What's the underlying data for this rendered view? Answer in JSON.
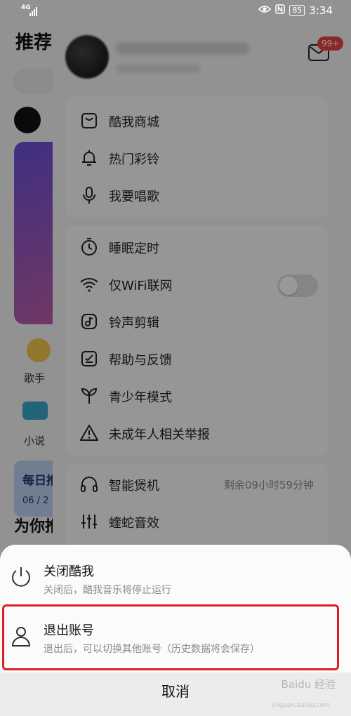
{
  "status_bar": {
    "network": "4G",
    "time": "3:34",
    "battery": "85",
    "icons": [
      "eye-icon",
      "nfc-icon",
      "signal-icon"
    ]
  },
  "background": {
    "title_partial": "推荐",
    "singer_label": "歌手",
    "novel_label": "小说",
    "daily_title": "每日推",
    "daily_date": "06 / 2",
    "section_title": "为你推"
  },
  "drawer": {
    "mail_badge": "99+",
    "group1": [
      {
        "icon": "shop-bag-icon",
        "label": "酷我商城"
      },
      {
        "icon": "bell-icon",
        "label": "热门彩铃"
      },
      {
        "icon": "microphone-icon",
        "label": "我要唱歌"
      }
    ],
    "group2": [
      {
        "icon": "timer-icon",
        "label": "睡眠定时"
      },
      {
        "icon": "wifi-icon",
        "label": "仅WiFi联网",
        "toggle_on": false
      },
      {
        "icon": "music-note-icon",
        "label": "铃声剪辑"
      },
      {
        "icon": "feedback-icon",
        "label": "帮助与反馈"
      },
      {
        "icon": "sprout-icon",
        "label": "青少年模式"
      },
      {
        "icon": "warning-icon",
        "label": "未成年人相关举报"
      }
    ],
    "group3": [
      {
        "icon": "headphones-icon",
        "label": "智能煲机",
        "extra": "剩余09小时59分钟"
      },
      {
        "icon": "equalizer-icon",
        "label": "蝰蛇音效"
      }
    ]
  },
  "sheet": {
    "power": {
      "title": "关闭酷我",
      "desc": "关闭后，酷我音乐将停止运行"
    },
    "logout": {
      "title": "退出账号",
      "desc": "退出后，可以切换其他账号（历史数据将会保存）"
    },
    "cancel": "取消"
  },
  "watermark": {
    "text": "Baidu 经验",
    "sub": "jingyan.baidu.com"
  },
  "colors": {
    "highlight": "#e11c22",
    "badge": "#e8433e",
    "overlay": "rgba(0,0,0,0.4)"
  }
}
